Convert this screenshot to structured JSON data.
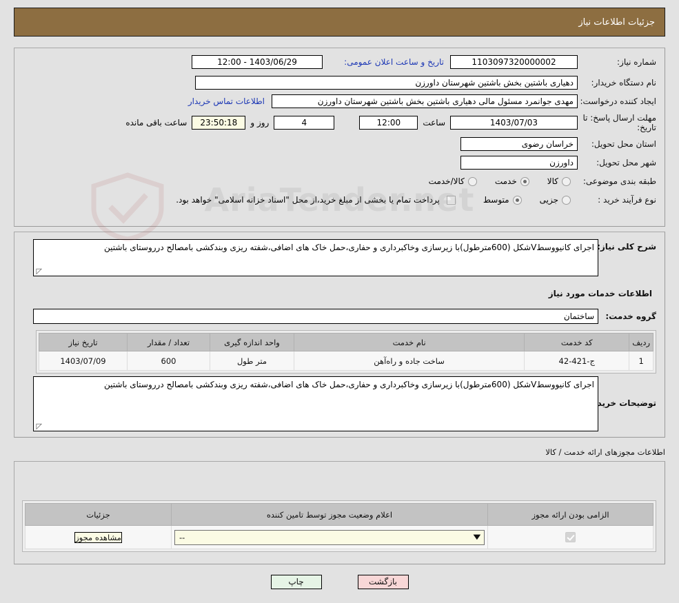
{
  "header": {
    "title": "جزئیات اطلاعات نیاز"
  },
  "main": {
    "need_number_label": "شماره نیاز:",
    "need_number_value": "1103097320000002",
    "announce_label": "تاریخ و ساعت اعلان عمومی:",
    "announce_value": "1403/06/29 - 12:00",
    "buyer_org_label": "نام دستگاه خریدار:",
    "buyer_org_value": "دهیاری باشتین بخش باشتین شهرستان داورزن",
    "creator_label": "ایجاد کننده درخواست:",
    "creator_value": "مهدی جوانمرد مسئول مالی دهیاری باشتین بخش باشتین شهرستان داورزن",
    "contact_link": "اطلاعات تماس خریدار",
    "deadline_label": "مهلت ارسال پاسخ: تا تاریخ:",
    "deadline_date": "1403/07/03",
    "deadline_hour_label": "ساعت",
    "deadline_hour": "12:00",
    "remaining_days": "4",
    "remaining_days_label": "روز و",
    "remaining_time": "23:50:18",
    "remaining_suffix": "ساعت باقی مانده",
    "province_label": "استان محل تحویل:",
    "province_value": "خراسان رضوی",
    "city_label": "شهر محل تحویل:",
    "city_value": "داورزن",
    "category_label": "طبقه بندی موضوعی:",
    "category_options": [
      {
        "label": "کالا",
        "selected": false
      },
      {
        "label": "خدمت",
        "selected": true
      },
      {
        "label": "کالا/خدمت",
        "selected": false
      }
    ],
    "process_label": "نوع فرآیند خرید :",
    "process_options": [
      {
        "label": "جزیی",
        "selected": false
      },
      {
        "label": "متوسط",
        "selected": true
      }
    ],
    "partial_payment_label": "پرداخت تمام یا بخشی از مبلغ خرید،از محل \"اسناد خزانه اسلامی\" خواهد بود."
  },
  "description": {
    "summary_label": "شرح کلی نیاز:",
    "summary_value": "اجرای کانیووسطVشکل (600مترطول)با زیرسازی وخاکبرداری و حفاری،حمل خاک های اضافی،شفته ریزی وبندکشی بامصالح درروستای باشتین",
    "services_header": "اطلاعات خدمات مورد نیاز",
    "service_group_label": "گروه خدمت:",
    "service_group_value": "ساختمان",
    "buyer_notes_label": "توضیحات خریدار:",
    "buyer_notes_value": "اجرای کانیووسطVشکل (600مترطول)با زیرسازی وخاکبرداری و حفاری،حمل خاک های اضافی،شفته ریزی وبندکشی بامصالح درروستای باشتین"
  },
  "services_table": {
    "columns": [
      "ردیف",
      "کد خدمت",
      "نام خدمت",
      "واحد اندازه گیری",
      "تعداد / مقدار",
      "تاریخ نیاز"
    ],
    "rows": [
      {
        "row": "1",
        "code": "ج-421-42",
        "name": "ساخت جاده و راه‌آهن",
        "unit": "متر طول",
        "quantity": "600",
        "date": "1403/07/09"
      }
    ]
  },
  "permits": {
    "section_title": "اطلاعات مجوزهای ارائه خدمت / کالا",
    "columns": [
      "الزامی بودن ارائه مجوز",
      "اعلام وضعیت مجوز توسط تامین کننده",
      "جزئیات"
    ],
    "rows": [
      {
        "required_checked": true,
        "status_value": "--",
        "detail_button": "مشاهده مجوز"
      }
    ]
  },
  "footer": {
    "print_label": "چاپ",
    "back_label": "بازگشت"
  },
  "watermark": {
    "text": "AriaTender.net"
  },
  "colors": {
    "header_bg": "#8d6e41",
    "page_bg": "#e2e2e2",
    "link": "#1c37b5",
    "print_btn": "#e6f4e6",
    "back_btn": "#f8d7d7",
    "field_yellow": "#fbfbe4"
  }
}
